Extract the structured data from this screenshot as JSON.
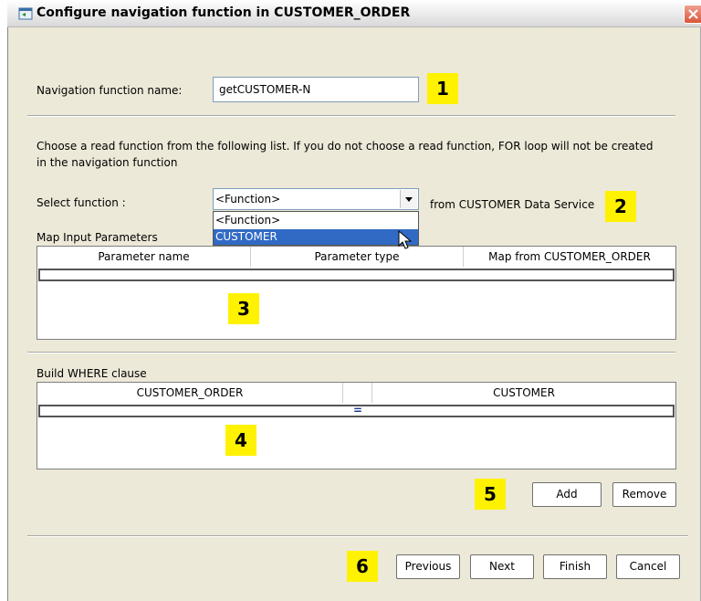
{
  "window": {
    "title": "Configure navigation function in CUSTOMER_ORDER"
  },
  "form": {
    "nav_name_label": "Navigation function name:",
    "nav_name_value": "getCUSTOMER-N",
    "instruction_line1": "Choose a read function from the following list. If you do not choose a read function, FOR loop will not be created",
    "instruction_line2": "in the navigation function",
    "select_label": "Select function :",
    "select_value": "<Function>",
    "select_options": [
      "<Function>",
      "CUSTOMER"
    ],
    "select_highlighted": "CUSTOMER",
    "from_text": "from CUSTOMER Data Service"
  },
  "input_params": {
    "section_label": "Map Input Parameters",
    "columns": [
      "Parameter name",
      "Parameter type",
      "Map from CUSTOMER_ORDER"
    ]
  },
  "where_clause": {
    "section_label": "Build WHERE clause",
    "columns": [
      "CUSTOMER_ORDER",
      "",
      "CUSTOMER"
    ],
    "operator": "="
  },
  "buttons": {
    "add": "Add",
    "remove": "Remove",
    "previous": "Previous",
    "next": "Next",
    "finish": "Finish",
    "cancel": "Cancel"
  },
  "callouts": [
    "1",
    "2",
    "3",
    "4",
    "5",
    "6"
  ],
  "colors": {
    "callout": "#fff200",
    "selection": "#316ac5",
    "dialog_bg": "#ece9d8"
  }
}
